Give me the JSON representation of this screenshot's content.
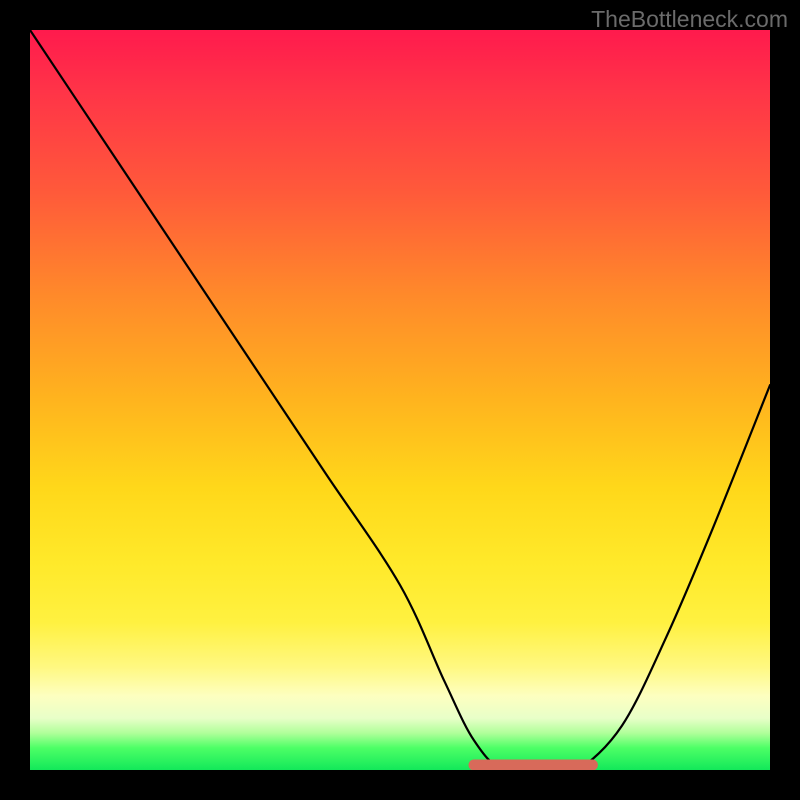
{
  "watermark": {
    "text": "TheBottleneck.com"
  },
  "chart_data": {
    "type": "line",
    "title": "",
    "xlabel": "",
    "ylabel": "",
    "xlim": [
      0,
      100
    ],
    "ylim": [
      0,
      100
    ],
    "grid": false,
    "legend": false,
    "series": [
      {
        "name": "bottleneck-curve",
        "x": [
          0,
          10,
          20,
          30,
          40,
          50,
          56,
          60,
          64,
          70,
          74,
          80,
          86,
          92,
          100
        ],
        "y": [
          100,
          85,
          70,
          55,
          40,
          25,
          12,
          4,
          0,
          0,
          0,
          6,
          18,
          32,
          52
        ]
      }
    ],
    "valley_band": {
      "x_start": 60,
      "x_end": 76,
      "color": "#d86a5a"
    },
    "background_gradient": {
      "stops": [
        {
          "pos": 0.0,
          "color": "#ff1a4d"
        },
        {
          "pos": 0.5,
          "color": "#ffb41e"
        },
        {
          "pos": 0.8,
          "color": "#fff140"
        },
        {
          "pos": 1.0,
          "color": "#12e85a"
        }
      ]
    }
  }
}
